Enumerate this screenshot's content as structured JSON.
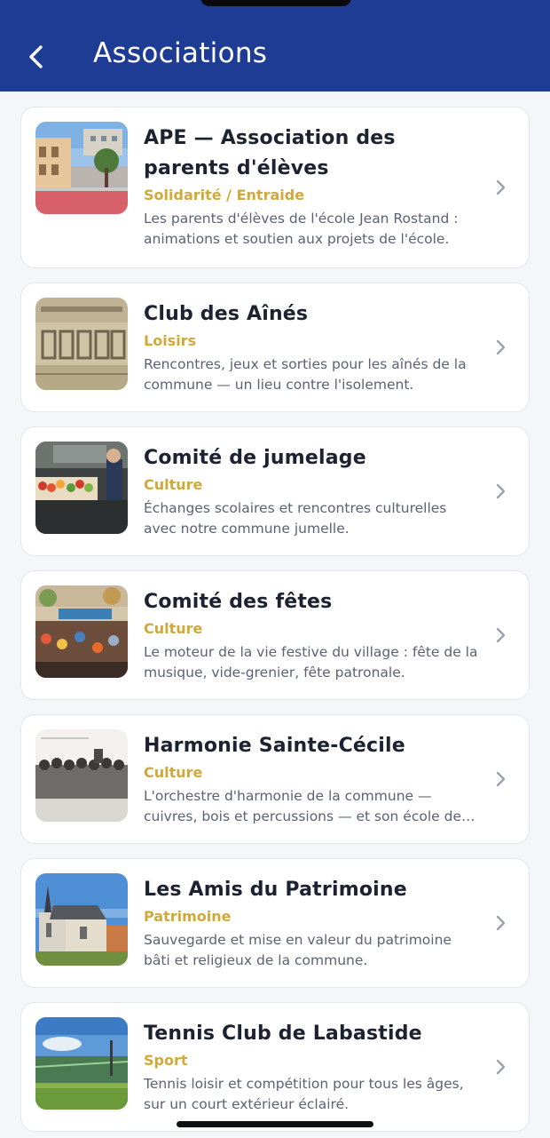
{
  "header": {
    "title": "Associations",
    "back_icon": "chevron-left-icon",
    "background": "#1f3c94"
  },
  "accent_category_color": "#d0a93a",
  "items": [
    {
      "title": "APE — Association des parents d'élèves",
      "category": "Solidarité / Entraide",
      "description": "Les parents d'élèves de l'école Jean Rostand : animations et soutien aux projets de l'école."
    },
    {
      "title": "Club des Aînés",
      "category": "Loisirs",
      "description": "Rencontres, jeux et sorties pour les aînés de la commune — un lieu contre l'isolement."
    },
    {
      "title": "Comité de jumelage",
      "category": "Culture",
      "description": "Échanges scolaires et rencontres culturelles avec notre commune jumelle."
    },
    {
      "title": "Comité des fêtes",
      "category": "Culture",
      "description": "Le moteur de la vie festive du village : fête de la musique, vide-grenier, fête patronale."
    },
    {
      "title": "Harmonie Sainte-Cécile",
      "category": "Culture",
      "description": "L'orchestre d'harmonie de la commune — cuivres, bois et percussions — et son école de musique."
    },
    {
      "title": "Les Amis du Patrimoine",
      "category": "Patrimoine",
      "description": "Sauvegarde et mise en valeur du patrimoine bâti et religieux de la commune."
    },
    {
      "title": "Tennis Club de Labastide",
      "category": "Sport",
      "description": "Tennis loisir et compétition pour tous les âges, sur un court extérieur éclairé."
    }
  ]
}
